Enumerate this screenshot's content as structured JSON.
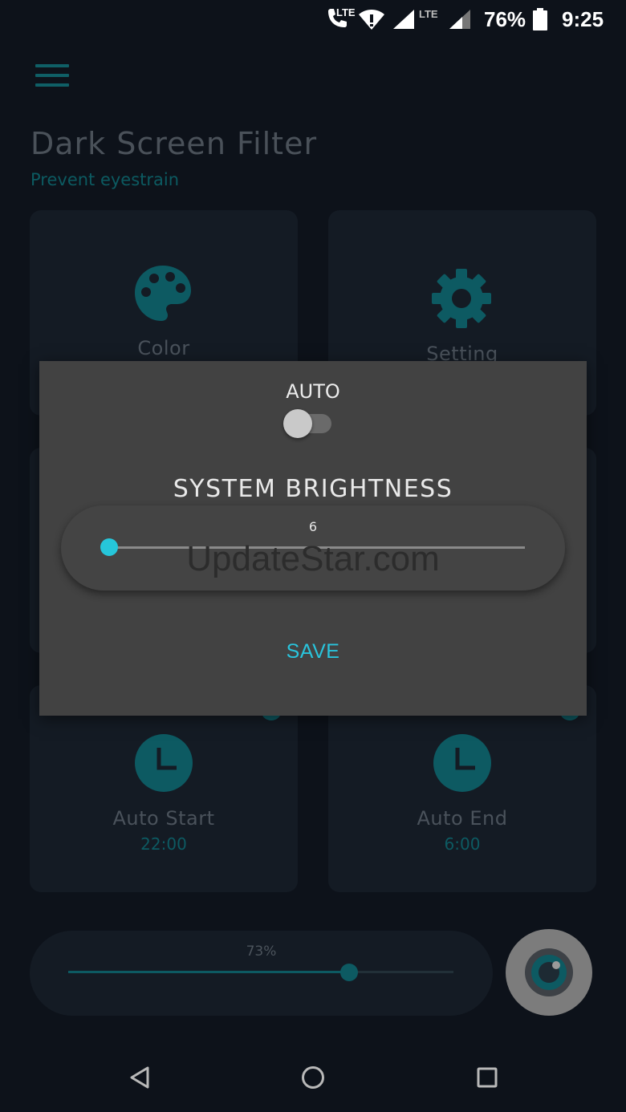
{
  "status_bar": {
    "network_tag_1": "LTE",
    "network_tag_2": "LTE",
    "battery": "76%",
    "time": "9:25"
  },
  "header": {
    "title": "Dark Screen Filter",
    "subtitle": "Prevent eyestrain"
  },
  "cards": {
    "color": {
      "label": "Color",
      "icon": "palette-icon"
    },
    "setting": {
      "label": "Setting",
      "icon": "gear-icon"
    },
    "auto_start": {
      "label": "Auto Start",
      "time": "22:00",
      "icon": "clock-icon"
    },
    "auto_end": {
      "label": "Auto End",
      "time": "6:00",
      "icon": "clock-icon"
    }
  },
  "filter": {
    "value_label": "73%",
    "level": 0.73
  },
  "dialog": {
    "auto_label": "AUTO",
    "auto_enabled": false,
    "heading": "SYSTEM BRIGHTNESS",
    "brightness_value": "6",
    "save_label": "SAVE"
  },
  "watermark": "UpdateStar.com",
  "colors": {
    "background": "#0d121a",
    "card": "#141b24",
    "teal_dark": "#0d5a62",
    "accent_cyan": "#26c6da",
    "dialog": "#424242"
  }
}
